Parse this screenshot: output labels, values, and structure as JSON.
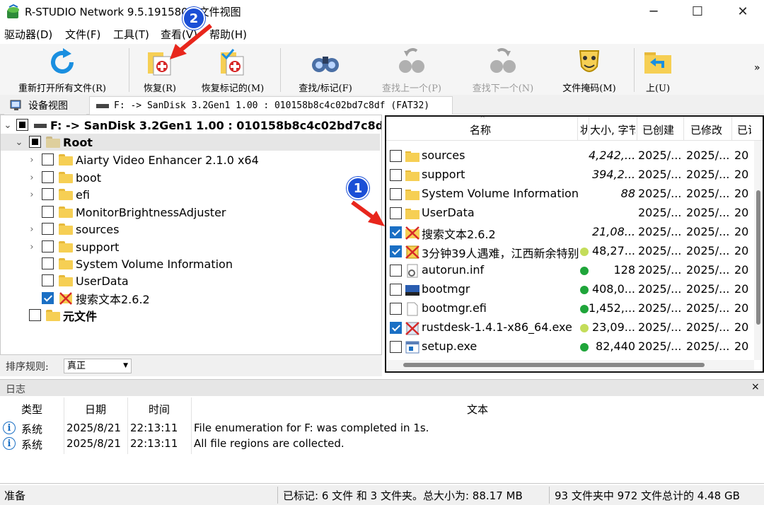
{
  "window": {
    "title": "R-STUDIO Network 9.5.191580 - 文件视图",
    "min": "─",
    "max": "☐",
    "close": "✕"
  },
  "menu": [
    "驱动器(D)",
    "文件(F)",
    "工具(T)",
    "查看(V)",
    "帮助(H)"
  ],
  "toolbar": {
    "reopen": "重新打开所有文件(R)",
    "recover": "恢复(R)",
    "recover_marked": "恢复标记的(M)",
    "find": "查找/标记(F)",
    "find_prev": "查找上一个(P)",
    "find_next": "查找下一个(N)",
    "file_mask": "文件掩码(M)",
    "up": "上(U)",
    "overflow": "»"
  },
  "tabs": {
    "device_view": "设备视图",
    "drive": "F: -> SanDisk 3.2Gen1 1.00 : 010158b8c4c02bd7c8df (FAT32)"
  },
  "tree": {
    "drive": "F: -> SanDisk 3.2Gen1 1.00 : 010158b8c4c02bd7c8df (FAT32)",
    "root": "Root",
    "items": [
      "Aiarty Video Enhancer 2.1.0 x64",
      "boot",
      "efi",
      "MonitorBrightnessAdjuster",
      "sources",
      "support",
      "System Volume Information",
      "UserData",
      "搜索文本2.6.2"
    ],
    "meta": "元文件"
  },
  "sort": {
    "label": "排序规则:",
    "value": "真正"
  },
  "file_list": {
    "headers": {
      "name": "名称",
      "flag": "状",
      "size": "大小, 字节",
      "created": "已创建",
      "modified": "已修改",
      "accessed": "已访问"
    },
    "rows": [
      {
        "name": "sources",
        "size": "4,242,...",
        "created": "2025/...",
        "modified": "2025/...",
        "accessed": "20",
        "checked": false,
        "icon": "folder-icon",
        "dot": ""
      },
      {
        "name": "support",
        "size": "394,2...",
        "created": "2025/...",
        "modified": "2025/...",
        "accessed": "20",
        "checked": false,
        "icon": "folder-icon",
        "dot": ""
      },
      {
        "name": "System Volume Information",
        "size": "88",
        "created": "2025/...",
        "modified": "2025/...",
        "accessed": "20",
        "checked": false,
        "icon": "folder-icon",
        "dot": ""
      },
      {
        "name": "UserData",
        "size": "",
        "created": "2025/...",
        "modified": "2025/...",
        "accessed": "20",
        "checked": false,
        "icon": "folder-icon",
        "dot": ""
      },
      {
        "name": "搜索文本2.6.2",
        "size": "21,08...",
        "created": "2025/...",
        "modified": "2025/...",
        "accessed": "20",
        "checked": true,
        "icon": "deleted-folder-icon",
        "dot": ""
      },
      {
        "name": "3分钟39人遇难，江西新余特别",
        "size": "48,27...",
        "created": "2025/...",
        "modified": "2025/...",
        "accessed": "20",
        "checked": true,
        "icon": "deleted-file-icon",
        "dot": "#c4dd5a"
      },
      {
        "name": "autorun.inf",
        "size": "128",
        "created": "2025/...",
        "modified": "2025/...",
        "accessed": "20",
        "checked": false,
        "icon": "settings-file-icon",
        "dot": "#1fa53a"
      },
      {
        "name": "bootmgr",
        "size": "408,0...",
        "created": "2025/...",
        "modified": "2025/...",
        "accessed": "20",
        "checked": false,
        "icon": "system-file-icon",
        "dot": "#1fa53a"
      },
      {
        "name": "bootmgr.efi",
        "size": "1,452,...",
        "created": "2025/...",
        "modified": "2025/...",
        "accessed": "20",
        "checked": false,
        "icon": "file-icon",
        "dot": "#1fa53a"
      },
      {
        "name": "rustdesk-1.4.1-x86_64.exe",
        "size": "23,09...",
        "created": "2025/...",
        "modified": "2025/...",
        "accessed": "20",
        "checked": true,
        "icon": "deleted-exe-icon",
        "dot": "#c4dd5a"
      },
      {
        "name": "setup.exe",
        "size": "82,440",
        "created": "2025/...",
        "modified": "2025/...",
        "accessed": "20",
        "checked": false,
        "icon": "exe-icon",
        "dot": "#1fa53a"
      }
    ]
  },
  "log": {
    "title": "日志",
    "close": "×",
    "headers": {
      "type": "类型",
      "date": "日期",
      "time": "时间",
      "text": "文本"
    },
    "rows": [
      {
        "type": "系统",
        "date": "2025/8/21",
        "time": "22:13:11",
        "text": "File enumeration for F: was completed in 1s."
      },
      {
        "type": "系统",
        "date": "2025/8/21",
        "time": "22:13:11",
        "text": "All file regions are collected."
      }
    ]
  },
  "status": {
    "ready": "准备",
    "marked": "已标记: 6 文件 和 3 文件夹。总大小为: 88.17 MB",
    "total": "93 文件夹中 972 文件总计的 4.48 GB"
  },
  "annotations": {
    "badge1": "1",
    "badge2": "2"
  },
  "colors": {
    "accent": "#1a6fc4",
    "annotation": "#1b4fd6",
    "arrow": "#e8261c",
    "folder": "#f6cf54",
    "dot_green": "#1fa53a",
    "dot_yellow": "#c4dd5a"
  }
}
